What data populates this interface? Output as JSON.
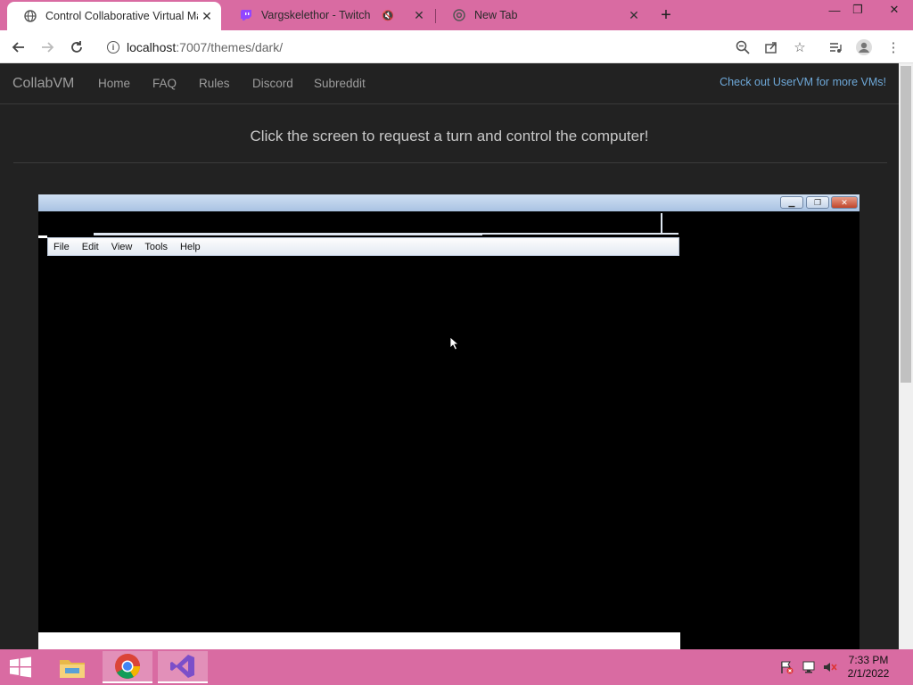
{
  "browser": {
    "tabs": [
      {
        "title": "Control Collaborative Virtual Ma",
        "active": true
      },
      {
        "title": "Vargskelethor - Twitch",
        "active": false,
        "muted": true
      },
      {
        "title": "New Tab",
        "active": false
      }
    ],
    "url_host": "localhost",
    "url_path": ":7007/themes/dark/"
  },
  "site": {
    "brand": "CollabVM",
    "nav": [
      "Home",
      "FAQ",
      "Rules",
      "Discord",
      "Subreddit"
    ],
    "promo_link": "Check out UserVM for more VMs!",
    "prompt": "Click the screen to request a turn and control the computer!"
  },
  "vm": {
    "menus": [
      "File",
      "Edit",
      "View",
      "Tools",
      "Help"
    ]
  },
  "taskbar": {
    "time": "7:33 PM",
    "date": "2/1/2022"
  },
  "colors": {
    "accent": "#d96ba2",
    "page_bg": "#222222",
    "link": "#6ea8d8"
  }
}
